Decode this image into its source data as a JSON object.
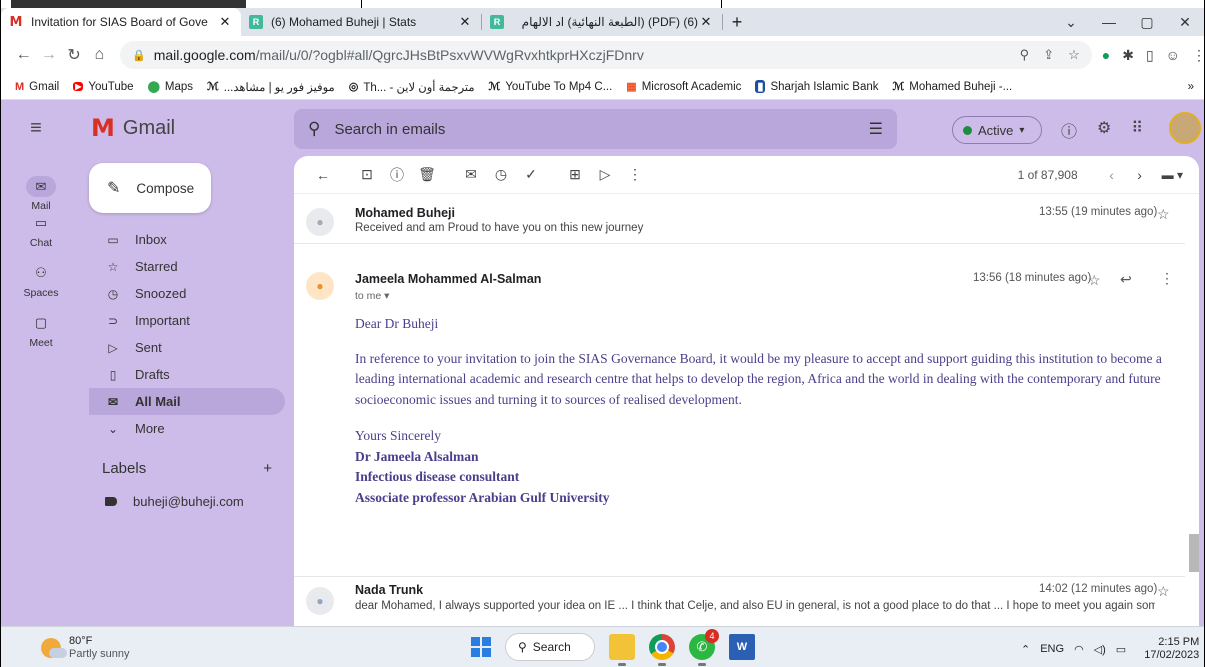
{
  "browser": {
    "tabs": [
      {
        "title": "Invitation for SIAS Board of Gove",
        "icon": "gmail-icon",
        "active": true
      },
      {
        "title": "(6) Mohamed Buheji | Stats",
        "icon": "researchgate-icon",
        "active": false
      },
      {
        "title": "(6) (PDF) (الطبعة النهائية) اد الالهام",
        "icon": "researchgate-icon",
        "active": false
      }
    ],
    "url_host": "mail.google.com",
    "url_path": "/mail/u/0/?ogbl#all/QgrcJHsBtPsxvWVWgRvxhtkprHXczjFDnrv",
    "bookmarks": [
      {
        "label": "Gmail",
        "icon": "gmail-icon"
      },
      {
        "label": "YouTube",
        "icon": "youtube-icon"
      },
      {
        "label": "Maps",
        "icon": "maps-icon"
      },
      {
        "label": "موفيز فور يو | مشاهد...",
        "icon": "bookmark-icon"
      },
      {
        "label": "Th... - مترجمة أون لاين",
        "icon": "globe-icon"
      },
      {
        "label": "YouTube To Mp4 C...",
        "icon": "bookmark-icon"
      },
      {
        "label": "Microsoft Academic",
        "icon": "microsoft-icon"
      },
      {
        "label": "Sharjah Islamic Bank",
        "icon": "bank-icon"
      },
      {
        "label": "Mohamed Buheji -...",
        "icon": "bookmark-icon"
      }
    ],
    "bookmarks_more": "»"
  },
  "gmail": {
    "app_name": "Gmail",
    "search_placeholder": "Search in emails",
    "status": "Active",
    "compose_label": "Compose",
    "rail": [
      {
        "label": "Mail",
        "icon": "mail-icon"
      },
      {
        "label": "Chat",
        "icon": "chat-icon"
      },
      {
        "label": "Spaces",
        "icon": "spaces-icon"
      },
      {
        "label": "Meet",
        "icon": "meet-icon"
      }
    ],
    "nav": [
      {
        "label": "Inbox",
        "icon": "inbox-icon"
      },
      {
        "label": "Starred",
        "icon": "star-icon"
      },
      {
        "label": "Snoozed",
        "icon": "clock-icon"
      },
      {
        "label": "Important",
        "icon": "important-icon"
      },
      {
        "label": "Sent",
        "icon": "send-icon"
      },
      {
        "label": "Drafts",
        "icon": "draft-icon"
      },
      {
        "label": "All Mail",
        "icon": "all-mail-icon"
      },
      {
        "label": "More",
        "icon": "chevron-down-icon"
      }
    ],
    "labels_title": "Labels",
    "label_items": [
      "buheji@buheji.com"
    ],
    "pager": "1 of 87,908",
    "messages": [
      {
        "from": "Mohamed Buheji",
        "snippet": "Received and am Proud to have you on this new journey",
        "time": "13:55 (19 minutes ago)"
      },
      {
        "from": "Jameela Mohammed Al-Salman",
        "to": "to me",
        "time": "13:56 (18 minutes ago)",
        "greeting": "Dear Dr Buheji",
        "body": "In reference to your invitation to join the SIAS Governance Board, it would be my pleasure to accept and support guiding this institution to become a leading international academic and research centre that helps to develop the region, Africa and the world in dealing with the contemporary and future socioeconomic issues and turning it to sources of realised development.",
        "closing": "Yours Sincerely",
        "sig_name": "Dr Jameela Alsalman",
        "sig_title": "Infectious disease consultant",
        "sig_affil": "Associate professor Arabian Gulf University"
      },
      {
        "from": "Nada Trunk",
        "snippet": "dear Mohamed, I always supported your idea on IE ... I think that Celje, and also EU in general, is not a good place to do that ... I hope to meet you again som",
        "time": "14:02 (12 minutes ago)"
      }
    ]
  },
  "taskbar": {
    "temp": "80°F",
    "weather": "Partly sunny",
    "search_label": "Search",
    "whatsapp_badge": "4",
    "lang": "ENG",
    "time": "2:15 PM",
    "date": "17/02/2023"
  }
}
